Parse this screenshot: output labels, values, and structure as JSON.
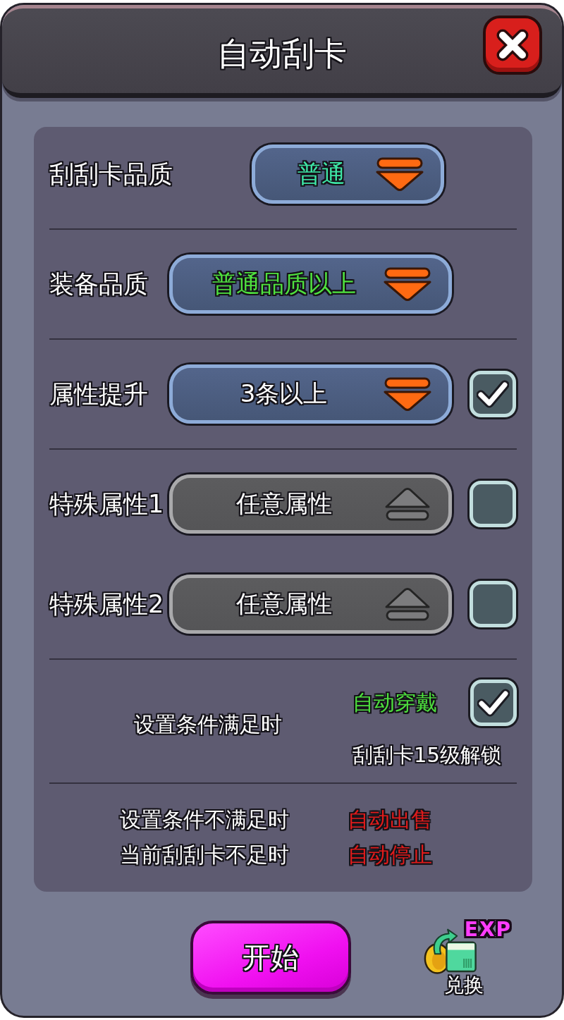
{
  "window": {
    "title": "自动刮卡"
  },
  "settings": [
    {
      "rows": [
        {
          "label": "刮刮卡品质",
          "value": "普通",
          "color": "#3ee6a6",
          "disabled": false
        }
      ]
    },
    {
      "rows": [
        {
          "label": "装备品质",
          "value": "普通品质以上",
          "color": "#4fe23f",
          "disabled": false
        }
      ]
    },
    {
      "rows": [
        {
          "label": "属性提升",
          "value": "3条以上",
          "color": "#ffffff",
          "disabled": false,
          "checkbox": {
            "checked": true
          }
        }
      ]
    },
    {
      "rows": [
        {
          "label": "特殊属性1",
          "value": "任意属性",
          "color": "#ffffff",
          "disabled": true,
          "checkbox": {
            "checked": false
          }
        },
        {
          "label": "特殊属性2",
          "value": "任意属性",
          "color": "#ffffff",
          "disabled": true,
          "checkbox": {
            "checked": false
          }
        }
      ]
    }
  ],
  "auto_equip": {
    "condition": "设置条件满足时",
    "action": "自动穿戴",
    "checked": true,
    "note": "刮刮卡15级解锁"
  },
  "fallbacks": [
    {
      "condition": "设置条件不满足时",
      "action": "自动出售"
    },
    {
      "condition": "当前刮刮卡不足时",
      "action": "自动停止"
    }
  ],
  "start_button": {
    "label": "开始"
  },
  "exchange": {
    "badge": "EXP",
    "label": "兑换"
  }
}
